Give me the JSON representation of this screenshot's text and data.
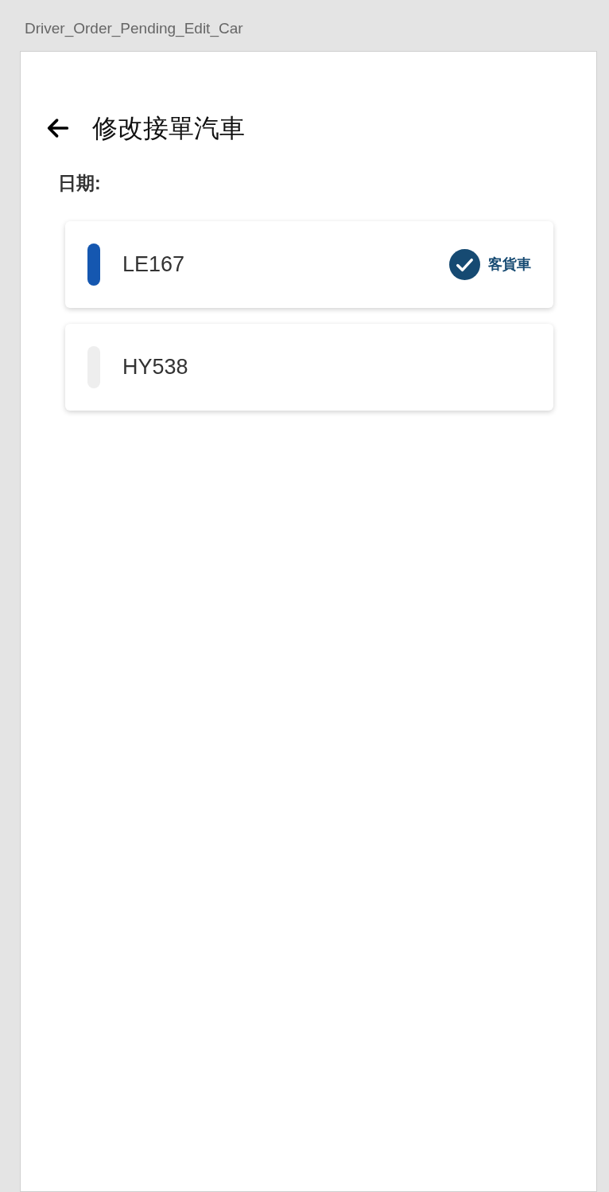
{
  "artboard": {
    "title": "Driver_Order_Pending_Edit_Car"
  },
  "header": {
    "title": "修改接單汽車"
  },
  "date_label": "日期:",
  "cars": [
    {
      "plate": "LE167",
      "selected": true,
      "type": "客貨車"
    },
    {
      "plate": "HY538",
      "selected": false
    }
  ]
}
